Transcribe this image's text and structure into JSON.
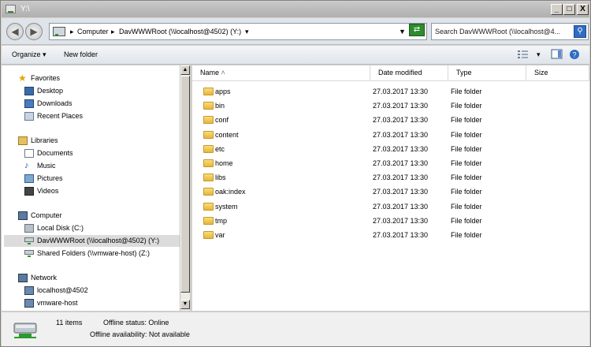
{
  "window": {
    "title": "Y:\\"
  },
  "titlebar_buttons": {
    "minimize": "_",
    "maximize": "□",
    "close": "X"
  },
  "address": {
    "crumbs": [
      "Computer",
      "DavWWWRoot (\\\\localhost@4502) (Y:)"
    ],
    "search_placeholder": "Search DavWWWRoot (\\\\localhost@4..."
  },
  "toolbar": {
    "organize": "Organize",
    "new_folder": "New folder"
  },
  "nav": {
    "favorites": {
      "label": "Favorites",
      "items": [
        "Desktop",
        "Downloads",
        "Recent Places"
      ]
    },
    "libraries": {
      "label": "Libraries",
      "items": [
        "Documents",
        "Music",
        "Pictures",
        "Videos"
      ]
    },
    "computer": {
      "label": "Computer",
      "items": [
        "Local Disk (C:)",
        "DavWWWRoot (\\\\localhost@4502) (Y:)",
        "Shared Folders (\\\\vmware-host) (Z:)"
      ]
    },
    "network": {
      "label": "Network",
      "items": [
        "localhost@4502",
        "vmware-host"
      ]
    }
  },
  "columns": {
    "name": "Name",
    "date": "Date modified",
    "type": "Type",
    "size": "Size"
  },
  "files": [
    {
      "name": "apps",
      "date": "27.03.2017 13:30",
      "type": "File folder"
    },
    {
      "name": "bin",
      "date": "27.03.2017 13:30",
      "type": "File folder"
    },
    {
      "name": "conf",
      "date": "27.03.2017 13:30",
      "type": "File folder"
    },
    {
      "name": "content",
      "date": "27.03.2017 13:30",
      "type": "File folder"
    },
    {
      "name": "etc",
      "date": "27.03.2017 13:30",
      "type": "File folder"
    },
    {
      "name": "home",
      "date": "27.03.2017 13:30",
      "type": "File folder"
    },
    {
      "name": "libs",
      "date": "27.03.2017 13:30",
      "type": "File folder"
    },
    {
      "name": "oak:index",
      "date": "27.03.2017 13:30",
      "type": "File folder"
    },
    {
      "name": "system",
      "date": "27.03.2017 13:30",
      "type": "File folder"
    },
    {
      "name": "tmp",
      "date": "27.03.2017 13:30",
      "type": "File folder"
    },
    {
      "name": "var",
      "date": "27.03.2017 13:30",
      "type": "File folder"
    }
  ],
  "status": {
    "items": "11 items",
    "offline_status": "Offline status: Online",
    "offline_availability": "Offline availability: Not available"
  },
  "colors": {
    "folder": "#e6b63c",
    "selection": "#dcdcdc",
    "refresh": "#2e8b2e"
  }
}
